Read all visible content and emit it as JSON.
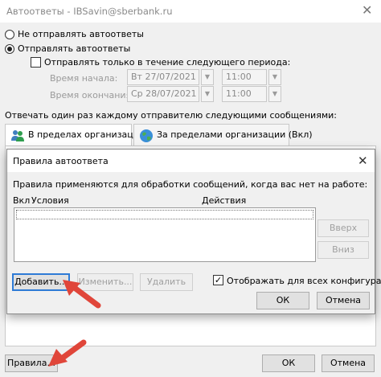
{
  "window": {
    "title": "Автоответы - IBSavin@sberbank.ru",
    "close_glyph": "✕"
  },
  "options": {
    "no_send_label": "Не отправлять автоответы",
    "send_label": "Отправлять автоответы",
    "selected": "send",
    "period_label": "Отправлять только в течение следующего периода:",
    "period_checked": false,
    "start_label": "Время начала:",
    "start_date": "Вт 27/07/2021",
    "start_time": "11:00",
    "end_label": "Время окончания:",
    "end_date": "Ср 28/07/2021",
    "end_time": "11:00"
  },
  "reply_once_label": "Отвечать один раз каждому отправителю следующими сообщениями:",
  "tabs": [
    {
      "label": "В пределах организации",
      "icon": "people-icon",
      "active": true
    },
    {
      "label": "За пределами организации (Вкл)",
      "icon": "globe-icon",
      "active": false
    }
  ],
  "outer_footer": {
    "rules_button": "Правила...",
    "ok_button": "ОК",
    "cancel_button": "Отмена"
  },
  "dialog": {
    "title": "Правила автоответа",
    "description": "Правила применяются для обработки сообщений, когда вас нет на работе:",
    "columns": [
      "Вкл",
      "Условия",
      "Действия"
    ],
    "up_button": "Вверх",
    "down_button": "Вниз",
    "add_button": "Добавить...",
    "edit_button": "Изменить...",
    "delete_button": "Удалить",
    "show_all_label": "Отображать для всех конфигураций",
    "show_all_checked": true,
    "ok_button": "ОК",
    "cancel_button": "Отмена"
  },
  "colors": {
    "focus_border": "#2e7bd6",
    "arrow": "#e0463a"
  }
}
